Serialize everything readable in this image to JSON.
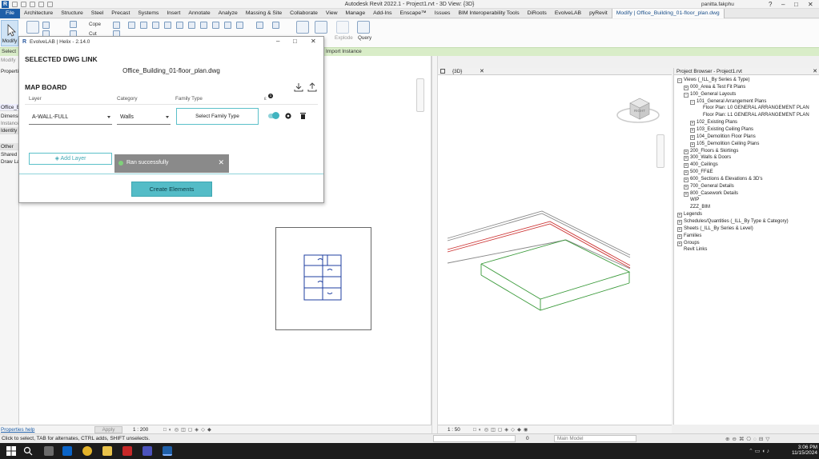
{
  "titlebar": {
    "title": "Autodesk Revit 2022.1 - Project1.rvt - 3D View: {3D}",
    "user": "panitta.fakphu"
  },
  "ribbon_tabs": [
    "File",
    "Architecture",
    "Structure",
    "Steel",
    "Precast",
    "Systems",
    "Insert",
    "Annotate",
    "Analyze",
    "Massing & Site",
    "Collaborate",
    "View",
    "Manage",
    "Add-Ins",
    "Enscape™",
    "Issues",
    "BIM Interoperability Tools",
    "DiRoots",
    "EvolveLAB",
    "pyRevit",
    "Modify | Office_Building_01-floor_plan.dwg"
  ],
  "ribbon": {
    "modify_label": "Modify",
    "cope_label": "Cope",
    "cut_label": "Cut",
    "explode_label": "Explode",
    "query_label": "Query",
    "import_instance_label": "Import Instance",
    "select_label": "Select",
    "modify_band": "Modify"
  },
  "left_panel": {
    "properties": "Properties",
    "office": "Office_B",
    "dimensions": "Dimensio",
    "instance": "Instance",
    "identity": "Identity D",
    "other": "Other",
    "shared": "Shared",
    "draw": "Draw La",
    "help": "Properties help",
    "apply": "Apply"
  },
  "dialog": {
    "title": "EvolveLAB | Helix - 2.14.0",
    "section_link": "SELECTED DWG LINK",
    "file_name": "Office_Building_01-floor_plan.dwg",
    "section_map": "MAP BOARD",
    "col_layer": "Layer",
    "col_category": "Category",
    "col_family": "Family Type",
    "badge": "1",
    "row": {
      "layer": "A-WALL-FULL",
      "category": "Walls",
      "family": "Select Family Type",
      "enabled": 1
    },
    "add_layer": "Add Layer",
    "toast": "Ran successfully",
    "create": "Create Elements"
  },
  "view_left": {
    "scale": "1 : 200"
  },
  "view_right": {
    "header": "{3D}",
    "scale": "1 : 50",
    "viewcube_label": "RIGHT"
  },
  "project_browser": {
    "title": "Project Browser - Project1.rvt",
    "items": [
      "Views (_ILL_By Series & Type)",
      "000_Area & Test Fit Plans",
      "100_General Layouts",
      "101_General Arrangement Plans",
      "Floor Plan: L0 GENERAL ARRANGEMENT PLAN",
      "Floor Plan: L1 GENERAL ARRANGEMENT PLAN",
      "102_Existing Plans",
      "103_Existing Ceiling Plans",
      "104_Demolition Floor Plans",
      "105_Demolition Ceiling Plans",
      "200_Floors & Skirtings",
      "300_Walls & Doors",
      "400_Ceilings",
      "500_FF&E",
      "600_Sections & Elevations & 3D's",
      "700_General Details",
      "800_Casework Details",
      "WIP",
      "ZZZ_BIM",
      "Legends",
      "Schedules/Quantities (_ILL_By Type & Category)",
      "Sheets (_ILL_By Series & Level)",
      "Families",
      "Groups",
      "Revit Links"
    ]
  },
  "status": {
    "text": "Click to select, TAB for alternates, CTRL adds, SHIFT unselects.",
    "zero": "0",
    "model": "Main Model"
  },
  "taskbar": {
    "time": "3:06 PM",
    "date": "11/15/2024"
  },
  "colors": {
    "accent": "#54bcc7",
    "revit_blue": "#1f5fa8",
    "plan_blue": "#1f3fa0"
  }
}
